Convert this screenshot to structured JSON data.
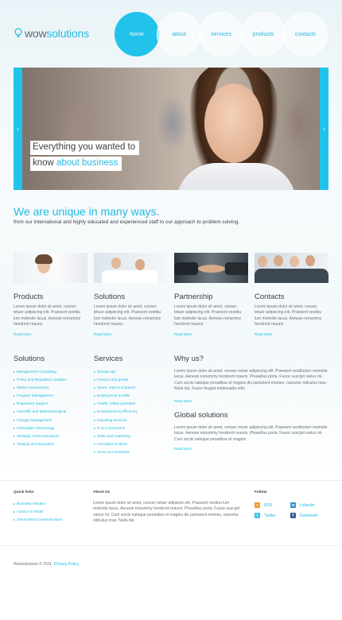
{
  "header": {
    "logo_part1": "wow",
    "logo_part2": "solutions",
    "nav": [
      {
        "label": "home",
        "active": true
      },
      {
        "label": "about",
        "active": false
      },
      {
        "label": "services",
        "active": false
      },
      {
        "label": "products",
        "active": false
      },
      {
        "label": "contacts",
        "active": false
      }
    ]
  },
  "slider": {
    "caption_line1": "Everything you wanted to",
    "caption_line2_prefix": "know ",
    "caption_line2_accent": "about business",
    "prev_icon": "chevron-left-icon",
    "next_icon": "chevron-right-icon"
  },
  "intro": {
    "headline": "We are unique in many ways.",
    "subhead": "from our international and highly educated and experienced staff to our approach to problem solving."
  },
  "features": [
    {
      "title": "Products",
      "text": "Lorem ipsum dolor sit amet, consec tetuer adipiscing elit. Praesent vestibu lum molestie lacus. Aenean nonummy hendrerit mauris.",
      "more": "Read More"
    },
    {
      "title": "Solutions",
      "text": "Lorem ipsum dolor sit amet, consec tetuer adipiscing elit. Praesent vestibu lum molestie lacus. Aenean nonummy hendrerit mauris.",
      "more": "Read More"
    },
    {
      "title": "Partnership",
      "text": "Lorem ipsum dolor sit amet, consec tetuer adipiscing elit. Praesent vestibu lum molestie lacus. Aenean nonummy hendrerit mauris.",
      "more": "Read More"
    },
    {
      "title": "Contacts",
      "text": "Lorem ipsum dolor sit amet, consec tetuer adipiscing elit. Praesent vestibu lum molestie lacus. Aenean nonummy hendrerit mauris.",
      "more": "Read More"
    }
  ],
  "solutions": {
    "title": "Solutions",
    "items": [
      "Management Consulting",
      "Policy and Regulatory analysis",
      "Market Assessment",
      "Program Management",
      "Regulatory Support",
      "Scientific and Biotechnological",
      "Change Management",
      "Information Technology",
      "Strategic Communications",
      "Training and Education"
    ]
  },
  "services": {
    "title": "Services",
    "items": [
      "Startup ups",
      "Finance and grants",
      "Taxes, returns & branch",
      "Employment & skills",
      "Health, safety premises",
      "Environment & efficiency",
      "Exporting services",
      "IT & e-commerce",
      "Sales and marketing",
      "Innovation & ideas",
      "Grow your business"
    ]
  },
  "why": {
    "title": "Why us?",
    "text": "Lorem ipsum dolor sit amet, consec tetuer adipiscing elit. Praesent vestibulum molestie lacus. Aenean nonummy hendrerit mauris. Phasellus porta. Fusce suscipit varius mi. Cum sociis natoque penatibus et magnis dis parturient montes, nascetur ridiculus mus. Nulla dui. Fusce feugiat malesuada odio.",
    "more": "Read More"
  },
  "global": {
    "title": "Global solutions",
    "text": "Lorem ipsum dolor sit amet, consec tetuer adipiscing elit. Praesent vestibulum molestie lacus. Aenean nonummy hendrerit mauris. Phasellus porta. Fusce suscipit varius mi. Cum sociis natoque penatibus et magnis.",
    "more": "Read More"
  },
  "footer": {
    "quick_title": "Quick links",
    "quick_links": [
      "Business Mindset",
      "Advisor in Retail",
      "Streamlined Communication"
    ],
    "about_title": "About Us",
    "about_text": "Lorem ipsum dolor sit amet, consec tetuer adipiscin elit. Praesent vestibu lum molestie lacus. Aenean nonummy hendrerit mauris. Phasellus porta. Fusce suscipit varius mi. Cum sociis natoque penatibus et magnis dis parturient montes, nascetur ridiculus mus. Nulla dui.",
    "follow_title": "Follow",
    "follow": [
      {
        "label": "RSS",
        "icon": "rss-icon",
        "color": "#f39a2a"
      },
      {
        "label": "Linkedin",
        "icon": "linkedin-icon",
        "color": "#2b8cc4"
      },
      {
        "label": "Twitter",
        "icon": "twitter-icon",
        "color": "#3ec1ea"
      },
      {
        "label": "Facebook",
        "icon": "facebook-icon",
        "color": "#3b5998"
      }
    ],
    "copyright": "Wowsolutions © 2011",
    "privacy": "Privacy Policy"
  },
  "colors": {
    "accent": "#22c3ea",
    "text_dark": "#3a3f44"
  }
}
